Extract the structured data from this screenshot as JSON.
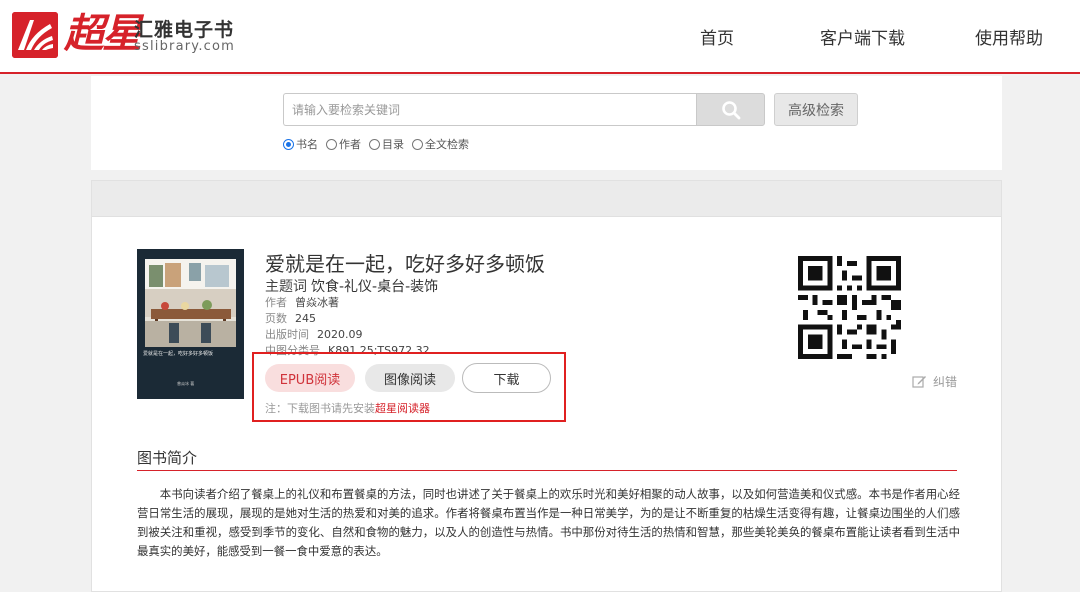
{
  "header": {
    "logo_script": "超星",
    "brand_name": "汇雅电子书",
    "brand_domain": "sslibrary.com",
    "nav": [
      "首页",
      "客户端下载",
      "使用帮助"
    ]
  },
  "search": {
    "placeholder": "请输入要检索关键词",
    "value": "",
    "advanced_label": "高级检索",
    "options": [
      "书名",
      "作者",
      "目录",
      "全文检索"
    ],
    "selected": "书名"
  },
  "book": {
    "title": "爱就是在一起，吃好多好多顿饭",
    "subject_label": "主题词",
    "subject": "饮食-礼仪-桌台-装饰",
    "meta": [
      {
        "label": "作者",
        "value": "曾焱冰著"
      },
      {
        "label": "页数",
        "value": "245"
      },
      {
        "label": "出版时间",
        "value": "2020.09"
      },
      {
        "label": "中图分类号",
        "value": "K891.25;TS972.32"
      }
    ],
    "cover_title": "爱就是在一起，吃好多好多顿饭",
    "cover_author": "曾焱冰 著",
    "actions": {
      "epub": "EPUB阅读",
      "image": "图像阅读",
      "download": "下载"
    },
    "note_prefix": "注：下载图书请先安装",
    "note_link": "超星阅读器",
    "correct_label": "纠错"
  },
  "intro": {
    "heading": "图书简介",
    "text": "本书向读者介绍了餐桌上的礼仪和布置餐桌的方法，同时也讲述了关于餐桌上的欢乐时光和美好相聚的动人故事，以及如何营造美和仪式感。本书是作者用心经营日常生活的展现，展现的是她对生活的热爱和对美的追求。作者将餐桌布置当作是一种日常美学，为的是让不断重复的枯燥生活变得有趣，让餐桌边围坐的人们感到被关注和重视，感受到季节的变化、自然和食物的魅力，以及人的创造性与热情。书中那份对待生活的热情和智慧，那些美轮美奂的餐桌布置能让读者看到生活中最真实的美好，能感受到一餐一食中爱意的表达。"
  },
  "colors": {
    "brand_red": "#d6222a",
    "epub_bg": "#f9dede",
    "highlight_box": "#e02020"
  }
}
